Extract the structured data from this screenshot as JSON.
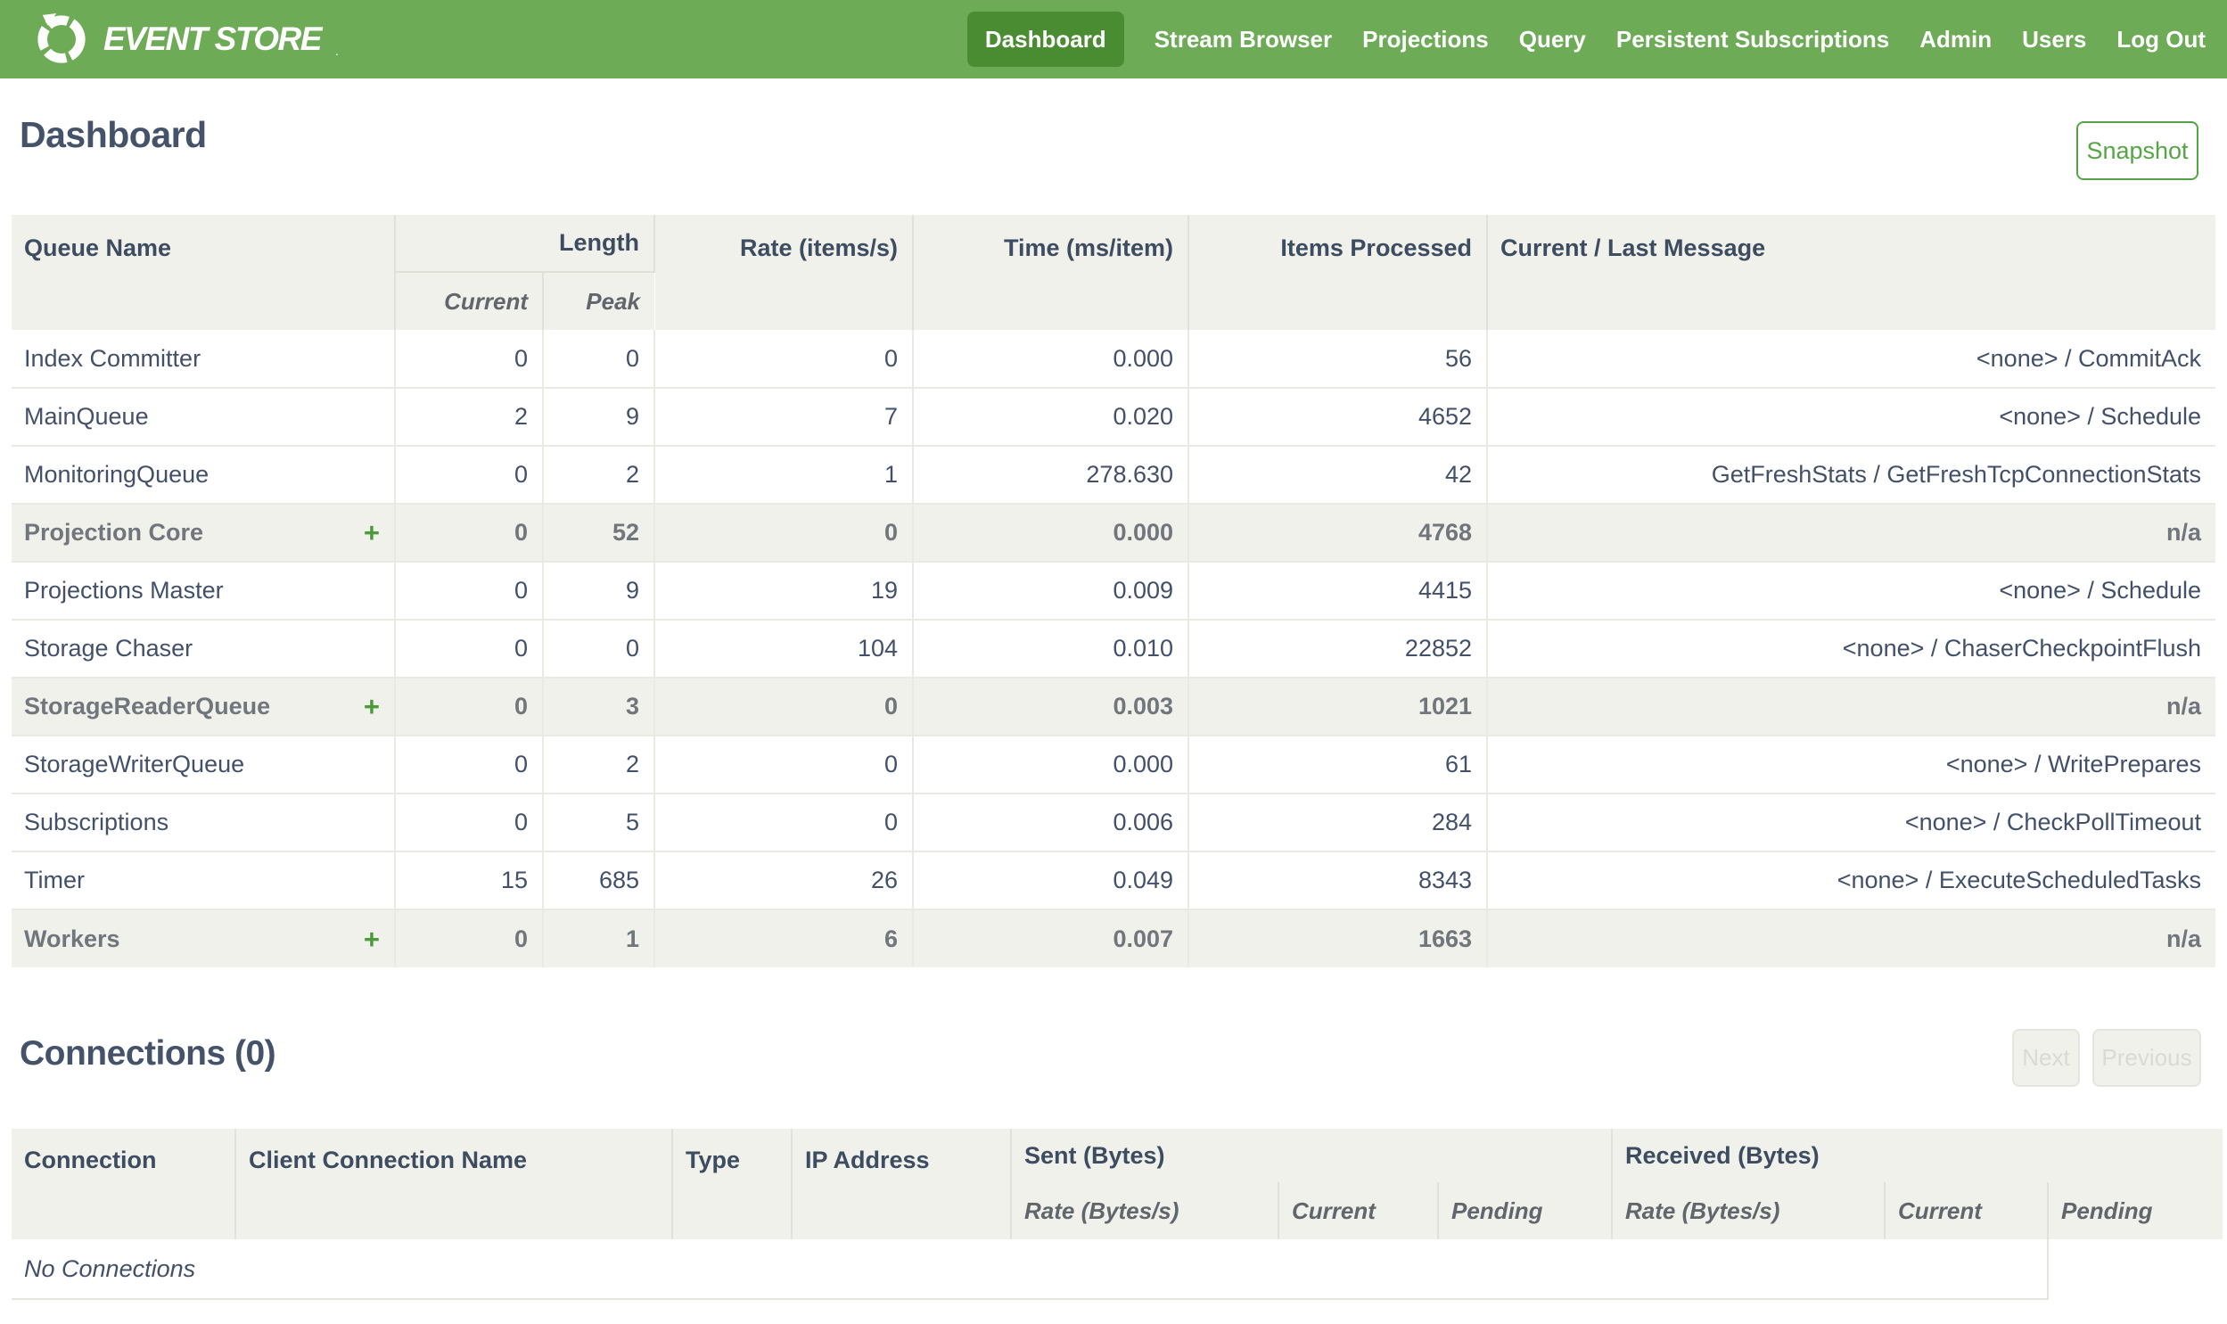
{
  "colors": {
    "navbar_green": "#6dab56",
    "active_green": "#4a8c32",
    "accent_green": "#55a545",
    "heading_slate": "#44536a",
    "header_bg": "#f0f1ea"
  },
  "nav": {
    "brand": "EVENT STORE",
    "brand_mark": ".",
    "items": [
      {
        "label": "Dashboard",
        "active": true
      },
      {
        "label": "Stream Browser",
        "active": false
      },
      {
        "label": "Projections",
        "active": false
      },
      {
        "label": "Query",
        "active": false
      },
      {
        "label": "Persistent Subscriptions",
        "active": false
      },
      {
        "label": "Admin",
        "active": false
      },
      {
        "label": "Users",
        "active": false
      },
      {
        "label": "Log Out",
        "active": false
      }
    ]
  },
  "page": {
    "title": "Dashboard",
    "snapshot_label": "Snapshot"
  },
  "queues": {
    "expand_icon": "+",
    "headers": {
      "queue_name": "Queue Name",
      "length": "Length",
      "current": "Current",
      "peak": "Peak",
      "rate": "Rate (items/s)",
      "time": "Time (ms/item)",
      "items_processed": "Items Processed",
      "message": "Current / Last Message"
    },
    "rows": [
      {
        "name": "Index Committer",
        "group": false,
        "expandable": false,
        "current": "0",
        "peak": "0",
        "rate": "0",
        "time": "0.000",
        "items": "56",
        "message": "<none> / CommitAck"
      },
      {
        "name": "MainQueue",
        "group": false,
        "expandable": false,
        "current": "2",
        "peak": "9",
        "rate": "7",
        "time": "0.020",
        "items": "4652",
        "message": "<none> / Schedule"
      },
      {
        "name": "MonitoringQueue",
        "group": false,
        "expandable": false,
        "current": "0",
        "peak": "2",
        "rate": "1",
        "time": "278.630",
        "items": "42",
        "message": "GetFreshStats / GetFreshTcpConnectionStats"
      },
      {
        "name": "Projection Core",
        "group": true,
        "expandable": true,
        "current": "0",
        "peak": "52",
        "rate": "0",
        "time": "0.000",
        "items": "4768",
        "message": "n/a"
      },
      {
        "name": "Projections Master",
        "group": false,
        "expandable": false,
        "current": "0",
        "peak": "9",
        "rate": "19",
        "time": "0.009",
        "items": "4415",
        "message": "<none> / Schedule"
      },
      {
        "name": "Storage Chaser",
        "group": false,
        "expandable": false,
        "current": "0",
        "peak": "0",
        "rate": "104",
        "time": "0.010",
        "items": "22852",
        "message": "<none> / ChaserCheckpointFlush"
      },
      {
        "name": "StorageReaderQueue",
        "group": true,
        "expandable": true,
        "current": "0",
        "peak": "3",
        "rate": "0",
        "time": "0.003",
        "items": "1021",
        "message": "n/a"
      },
      {
        "name": "StorageWriterQueue",
        "group": false,
        "expandable": false,
        "current": "0",
        "peak": "2",
        "rate": "0",
        "time": "0.000",
        "items": "61",
        "message": "<none> / WritePrepares"
      },
      {
        "name": "Subscriptions",
        "group": false,
        "expandable": false,
        "current": "0",
        "peak": "5",
        "rate": "0",
        "time": "0.006",
        "items": "284",
        "message": "<none> / CheckPollTimeout"
      },
      {
        "name": "Timer",
        "group": false,
        "expandable": false,
        "current": "15",
        "peak": "685",
        "rate": "26",
        "time": "0.049",
        "items": "8343",
        "message": "<none> / ExecuteScheduledTasks"
      },
      {
        "name": "Workers",
        "group": true,
        "expandable": true,
        "current": "0",
        "peak": "1",
        "rate": "6",
        "time": "0.007",
        "items": "1663",
        "message": "n/a"
      }
    ]
  },
  "connections": {
    "title": "Connections (0)",
    "next_label": "Next",
    "previous_label": "Previous",
    "headers": {
      "connection": "Connection",
      "client_connection_name": "Client Connection Name",
      "type": "Type",
      "ip_address": "IP Address",
      "sent_group": "Sent (Bytes)",
      "received_group": "Received (Bytes)",
      "rate": "Rate (Bytes/s)",
      "current": "Current",
      "pending": "Pending"
    },
    "empty_text": "No Connections"
  }
}
